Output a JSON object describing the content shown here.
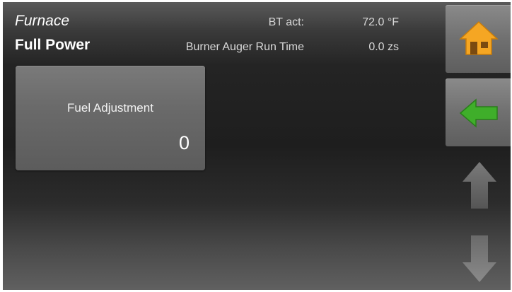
{
  "header": {
    "title": "Furnace",
    "subtitle": "Full Power"
  },
  "readouts": {
    "bt_label": "BT act:",
    "bt_value": "72.0 °F",
    "auger_label": "Burner Auger Run Time",
    "auger_value": "0.0 zs"
  },
  "tile": {
    "label": "Fuel Adjustment",
    "value": "0"
  },
  "nav": {
    "home_icon": "home-icon",
    "back_icon": "back-arrow-icon",
    "up_icon": "up-arrow-icon",
    "down_icon": "down-arrow-icon"
  },
  "colors": {
    "home_icon": "#f5a623",
    "back_icon": "#3fae2a",
    "disabled_arrow": "#6f6f6f"
  }
}
